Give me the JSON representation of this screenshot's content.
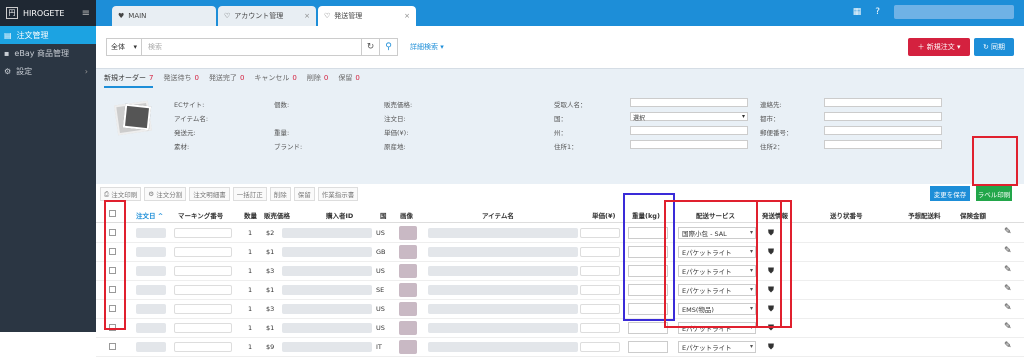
{
  "sidebar": {
    "brand": "HIROGETE",
    "items": [
      {
        "label": "注文管理",
        "active": true
      },
      {
        "label": "eBay 商品管理"
      },
      {
        "label": "設定"
      }
    ]
  },
  "tabs": [
    {
      "label": "MAIN"
    },
    {
      "label": "アカウント管理"
    },
    {
      "label": "発送管理"
    }
  ],
  "search": {
    "scope": "全体",
    "placeholder": "検索",
    "advanced": "詳細検索"
  },
  "buttons": {
    "new_order": "新規注文",
    "sync": "同期",
    "save_changes": "変更を保存",
    "label_print": "ラベル印刷"
  },
  "status_tabs": [
    {
      "label": "新規オーダー",
      "count": "7"
    },
    {
      "label": "発送待ち",
      "count": "0"
    },
    {
      "label": "発送完了",
      "count": "0"
    },
    {
      "label": "キャンセル",
      "count": "0"
    },
    {
      "label": "削除",
      "count": "0"
    },
    {
      "label": "保留",
      "count": "0"
    }
  ],
  "detail": {
    "c1": [
      "ECサイト:",
      "アイテム名:",
      "発送元:",
      "素材:"
    ],
    "c2": [
      "個数:",
      "",
      "重量:",
      "ブランド:"
    ],
    "c3": [
      "販売価格:",
      "注文日:",
      "単価(¥):",
      "原産地:"
    ],
    "c4": [
      "受取人名：",
      "国：",
      "州：",
      "住所1："
    ],
    "c5": [
      "連絡先:",
      "都市：",
      "郵便番号：",
      "住所2："
    ],
    "country_select": "選択"
  },
  "toolbar": [
    "注文印刷",
    "注文分割",
    "注文明細書",
    "一括訂正",
    "削除",
    "保留",
    "作業指示書"
  ],
  "columns": {
    "order_date": "注文日",
    "marking": "マーキング番号",
    "qty": "数量",
    "price": "販売価格",
    "buyer": "購入者ID",
    "country": "国",
    "image": "画像",
    "item": "アイテム名",
    "unit": "単価(¥)",
    "weight": "重量(kg)",
    "ship_service": "配送サービス",
    "ship_info": "発送情報",
    "tracking": "送り状番号",
    "est_fee": "予想配送料",
    "insurance": "保険金額"
  },
  "rows": [
    {
      "qty": "1",
      "price": "$2",
      "country": "US",
      "service": "国際小包 - SAL"
    },
    {
      "qty": "1",
      "price": "$1",
      "country": "GB",
      "service": "Eパケットライト"
    },
    {
      "qty": "1",
      "price": "$3",
      "country": "US",
      "service": "Eパケットライト"
    },
    {
      "qty": "1",
      "price": "$1",
      "country": "SE",
      "service": "Eパケットライト"
    },
    {
      "qty": "1",
      "price": "$3",
      "country": "US",
      "service": "EMS(物品)"
    },
    {
      "qty": "1",
      "price": "$1",
      "country": "US",
      "service": "Eパケットライト"
    },
    {
      "qty": "1",
      "price": "$9",
      "country": "IT",
      "service": "Eパケットライト"
    }
  ]
}
